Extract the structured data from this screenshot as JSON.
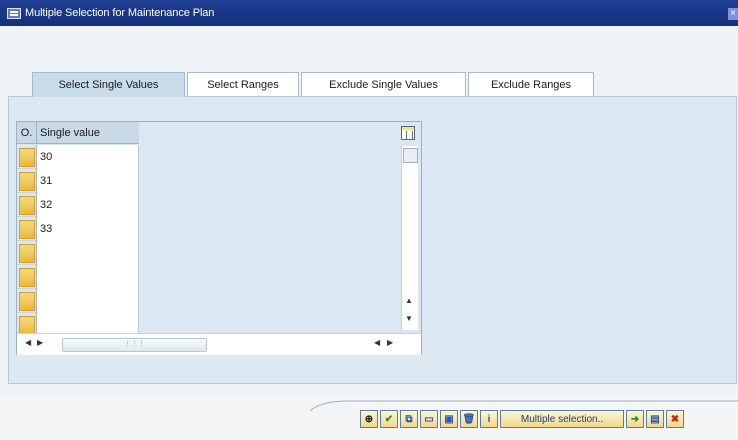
{
  "window": {
    "title": "Multiple Selection for Maintenance Plan"
  },
  "tabs": [
    {
      "label": "Select Single Values",
      "active": true
    },
    {
      "label": "Select Ranges",
      "active": false
    },
    {
      "label": "Exclude Single Values",
      "active": false
    },
    {
      "label": "Exclude Ranges",
      "active": false
    }
  ],
  "table": {
    "columns": [
      "O.",
      "Single value"
    ],
    "rows": [
      "30",
      "31",
      "32",
      "33",
      "",
      "",
      "",
      ""
    ]
  },
  "toolbar": {
    "buttons": [
      {
        "icon": "execute-icon"
      },
      {
        "icon": "check-icon"
      },
      {
        "icon": "insert-row-icon"
      },
      {
        "icon": "delete-row-icon"
      },
      {
        "icon": "select-block-icon"
      },
      {
        "icon": "trash-icon"
      },
      {
        "icon": "info-icon"
      },
      {
        "label": "Multiple selection.."
      },
      {
        "icon": "import-icon"
      },
      {
        "icon": "clipboard-icon"
      },
      {
        "icon": "cancel-icon"
      }
    ]
  }
}
